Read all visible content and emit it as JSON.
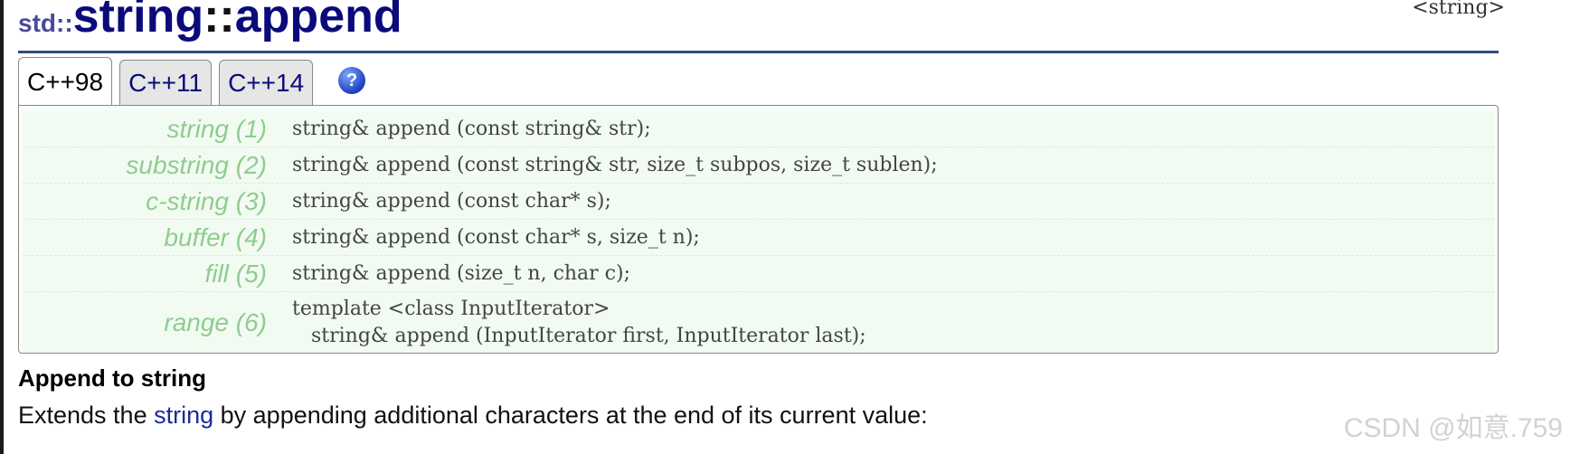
{
  "header": {
    "namespace": "std::",
    "name": "string",
    "separator": "::",
    "member": "append",
    "library": "<string>"
  },
  "tabs": [
    {
      "label": "C++98",
      "selected": true
    },
    {
      "label": "C++11",
      "selected": false
    },
    {
      "label": "C++14",
      "selected": false
    }
  ],
  "help_icon": {
    "glyph": "?",
    "icon": "help-icon"
  },
  "prototypes": [
    {
      "label": "string (1)",
      "code": "string& append (const string& str);"
    },
    {
      "label": "substring (2)",
      "code": "string& append (const string& str, size_t subpos, size_t sublen);"
    },
    {
      "label": "c-string (3)",
      "code": "string& append (const char* s);"
    },
    {
      "label": "buffer (4)",
      "code": "string& append (const char* s, size_t n);"
    },
    {
      "label": "fill (5)",
      "code": "string& append (size_t n, char c);"
    },
    {
      "label": "range (6)",
      "code": "template <class InputIterator>\n   string& append (InputIterator first, InputIterator last);"
    }
  ],
  "description": {
    "heading": "Append to string",
    "text_before": "Extends the ",
    "link": "string",
    "text_after": " by appending additional characters at the end of its current value:"
  },
  "watermark": "CSDN @如意.759",
  "colors": {
    "accent": "#2b4b83",
    "label_green": "#8fcc8f",
    "panel_bg": "#f6fff6"
  }
}
